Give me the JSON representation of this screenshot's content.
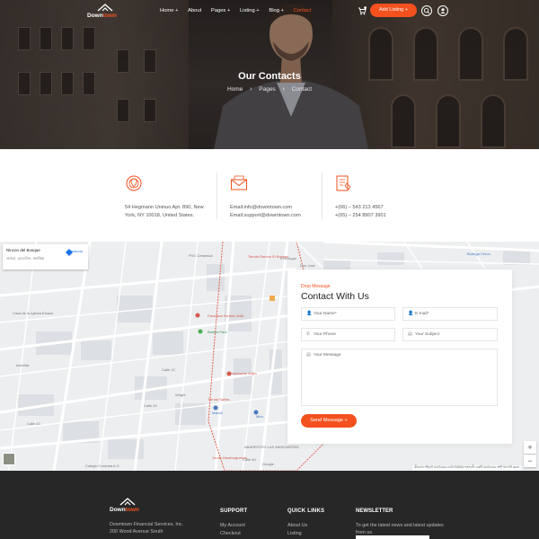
{
  "nav": {
    "logo_part1": "Down",
    "logo_part2": "town",
    "menu": [
      {
        "label": "Home +"
      },
      {
        "label": "About"
      },
      {
        "label": "Pages +"
      },
      {
        "label": "Listing +"
      },
      {
        "label": "Blog +"
      },
      {
        "label": "Contact"
      }
    ],
    "add_listing_label": "Add Listing  +",
    "icons": {
      "cart": "cart-icon",
      "search": "search-icon",
      "user": "user-icon"
    }
  },
  "hero": {
    "title": "Our Contacts",
    "breadcrumbs": [
      "Home",
      "Pages",
      "Contact"
    ]
  },
  "info": {
    "address": {
      "icon": "map-pin-icon",
      "line1": "54 Hegmann Uninuo Apt. 890, New",
      "line2": "York, NY 10018, United States."
    },
    "email": {
      "icon": "envelope-icon",
      "line1": "Email:info@dowmtown.com",
      "line2": "Email:support@dowmtown.com"
    },
    "phone": {
      "icon": "phone-list-icon",
      "line1": "+(06) – 543 213 4567",
      "line2": "+(05) – 254 8907 3901"
    }
  },
  "map": {
    "card_title": "Rincon del Bosque",
    "card_sub": "আমরা, মেডেলিন, কলম্বিয়া",
    "directions_label": "Directions",
    "attribution": "কীবোর্ড শর্টকাট  মানচিত্রের ডেটা ©2024  শর্তাবলী  একটি মানচিত্রের ত্রুটি রিপোর্ট করুন",
    "labels": [
      {
        "text": "PVC Cerámica",
        "cls": "gl"
      },
      {
        "text": "Tienda Ramon El Bosque",
        "cls": "gl red"
      },
      {
        "text": "El Bosque",
        "cls": "gl"
      },
      {
        "text": "Don Jose",
        "cls": "gl"
      },
      {
        "text": "Bodega Cerca",
        "cls": "gl blue"
      },
      {
        "text": "Casa de la Iglesia Emaús",
        "cls": "gl"
      },
      {
        "text": "Farmacia Farmal UMA",
        "cls": "gl red"
      },
      {
        "text": "Betello Park",
        "cls": "gl green"
      },
      {
        "text": "Restaurante Vejito",
        "cls": "gl red"
      },
      {
        "text": "Tienda Sañas",
        "cls": "gl red"
      },
      {
        "text": "Manoli",
        "cls": "gl blue"
      },
      {
        "text": "Mira",
        "cls": "gl blue"
      },
      {
        "text": "ABARROTES LAS MARGARITAS",
        "cls": "gl"
      },
      {
        "text": "Jonas Hamburguesas",
        "cls": "gl red"
      },
      {
        "text": "Wright",
        "cls": "gl"
      },
      {
        "text": "Colegio Cordoba A.C.",
        "cls": "gl"
      },
      {
        "text": "Calle 43",
        "cls": "gl"
      },
      {
        "text": "Calle 42",
        "cls": "gl"
      },
      {
        "text": "Calle 12",
        "cls": "gl"
      },
      {
        "text": "Calle 40",
        "cls": "gl"
      },
      {
        "text": "Avenida",
        "cls": "gl"
      },
      {
        "text": "Google",
        "cls": "gl"
      }
    ]
  },
  "form": {
    "kicker": "Drop Message",
    "title": "Contact With Us",
    "name_placeholder": "Your Name*",
    "email_placeholder": "E-mail*",
    "phone_placeholder": "Your Phone",
    "subject_placeholder": "Your Subject",
    "message_placeholder": "Your Message",
    "send_label": "Send Message  +"
  },
  "footer": {
    "logo_part1": "Down",
    "logo_part2": "town",
    "address_line1": "Downtown Financial Services, Inc.",
    "address_line2": "200 Wood Avenue South",
    "support_title": "SUPPORT",
    "support_links": [
      "My Account",
      "Checkout"
    ],
    "quick_title": "QUICK LINKS",
    "quick_links": [
      "About Us",
      "Listing"
    ],
    "news_title": "NEWSLETTER",
    "news_text": "To get the latest news and latest updates from us."
  },
  "colors": {
    "accent": "#f4511e",
    "footer_bg": "#272727"
  }
}
